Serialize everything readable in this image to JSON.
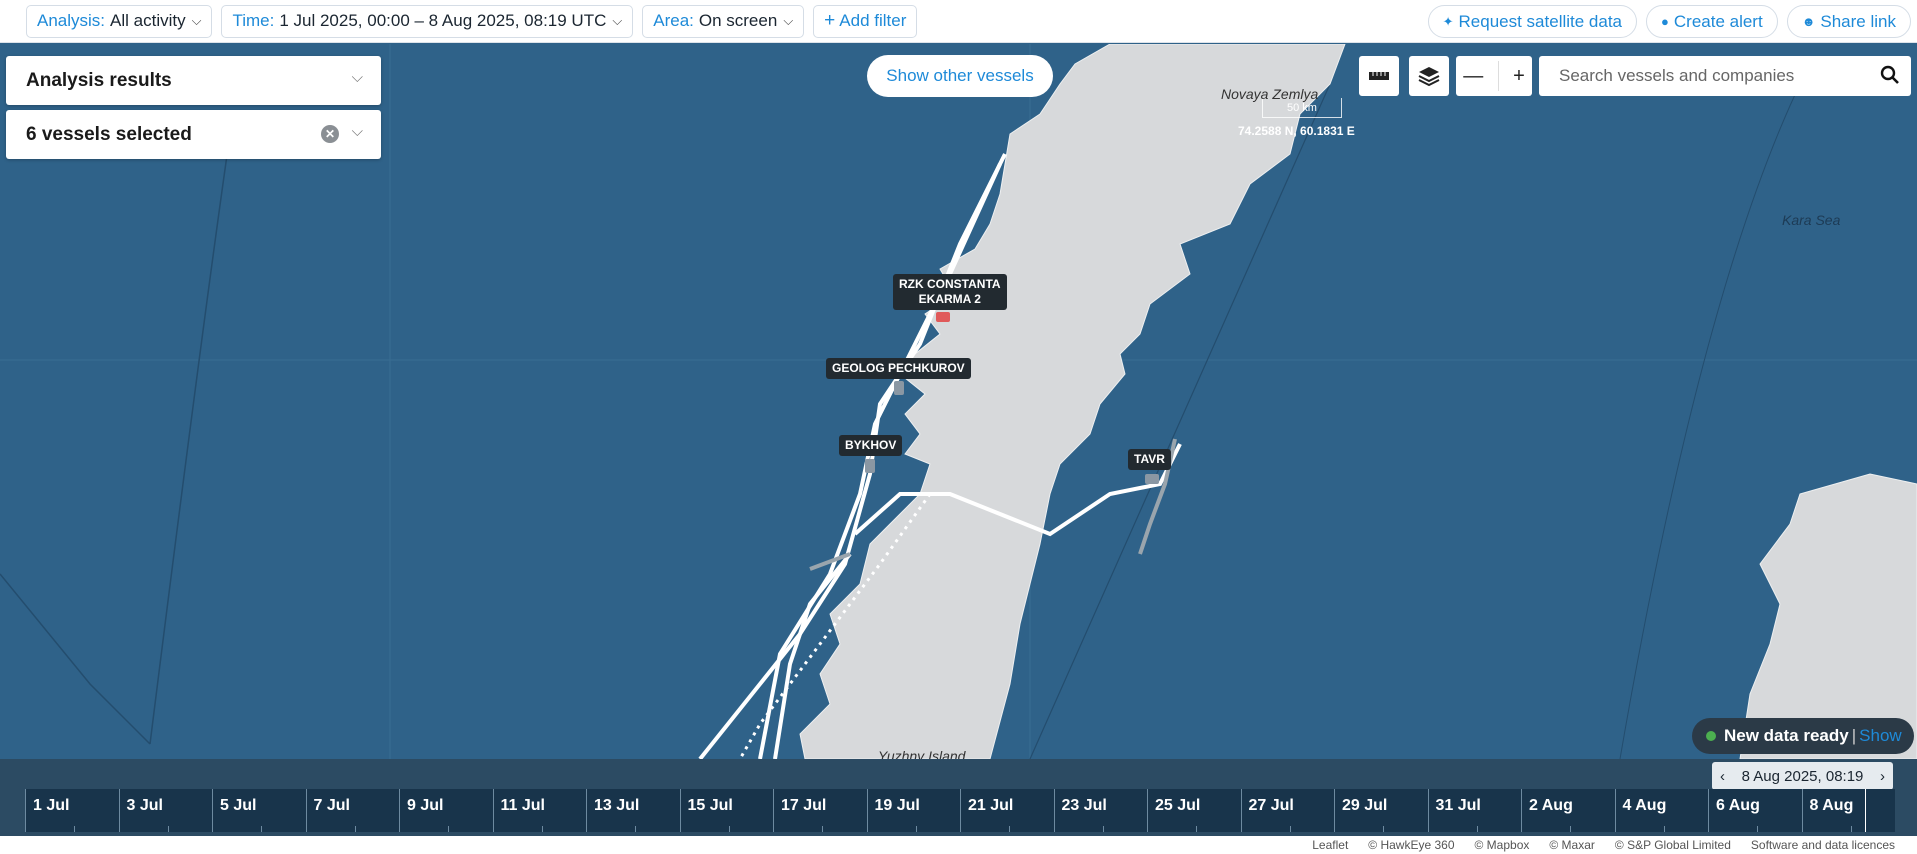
{
  "filters": {
    "analysis": {
      "label": "Analysis:",
      "value": "All activity"
    },
    "time": {
      "label": "Time:",
      "value": "1 Jul 2025, 00:00 – 8 Aug 2025, 08:19 UTC"
    },
    "area": {
      "label": "Area:",
      "value": "On screen"
    },
    "add_filter": "Add filter"
  },
  "actions": {
    "request_satellite": "Request satellite data",
    "create_alert": "Create alert",
    "share_link": "Share link"
  },
  "panels": {
    "analysis_results": "Analysis results",
    "vessels_selected": "6 vessels selected"
  },
  "map": {
    "show_other_vessels": "Show other vessels",
    "search_placeholder": "Search vessels and companies",
    "scale_label": "50 km",
    "coords": "74.2588 N, 60.1831 E",
    "places": {
      "novaya": "Novaya Zemlya",
      "kara": "Kara Sea",
      "yuzhny": "Yuzhny Island"
    },
    "vessels": [
      {
        "name": "RZK CONSTANTA"
      },
      {
        "name": "EKARMA 2"
      },
      {
        "name": "GEOLOG PECHKUROV"
      },
      {
        "name": "BYKHOV"
      },
      {
        "name": "TAVR"
      }
    ],
    "new_data": {
      "text": "New data ready",
      "separator": "|",
      "action": "Show"
    }
  },
  "timeline": {
    "ticks": [
      "1 Jul",
      "3 Jul",
      "5 Jul",
      "7 Jul",
      "9 Jul",
      "11 Jul",
      "13 Jul",
      "15 Jul",
      "17 Jul",
      "19 Jul",
      "21 Jul",
      "23 Jul",
      "25 Jul",
      "27 Jul",
      "29 Jul",
      "31 Jul",
      "2 Aug",
      "4 Aug",
      "6 Aug",
      "8 Aug"
    ],
    "current": "8 Aug 2025, 08:19"
  },
  "footer": [
    "Leaflet",
    "© HawkEye 360",
    "© Mapbox",
    "© Maxar",
    "© S&P Global Limited",
    "Software and data licences"
  ]
}
